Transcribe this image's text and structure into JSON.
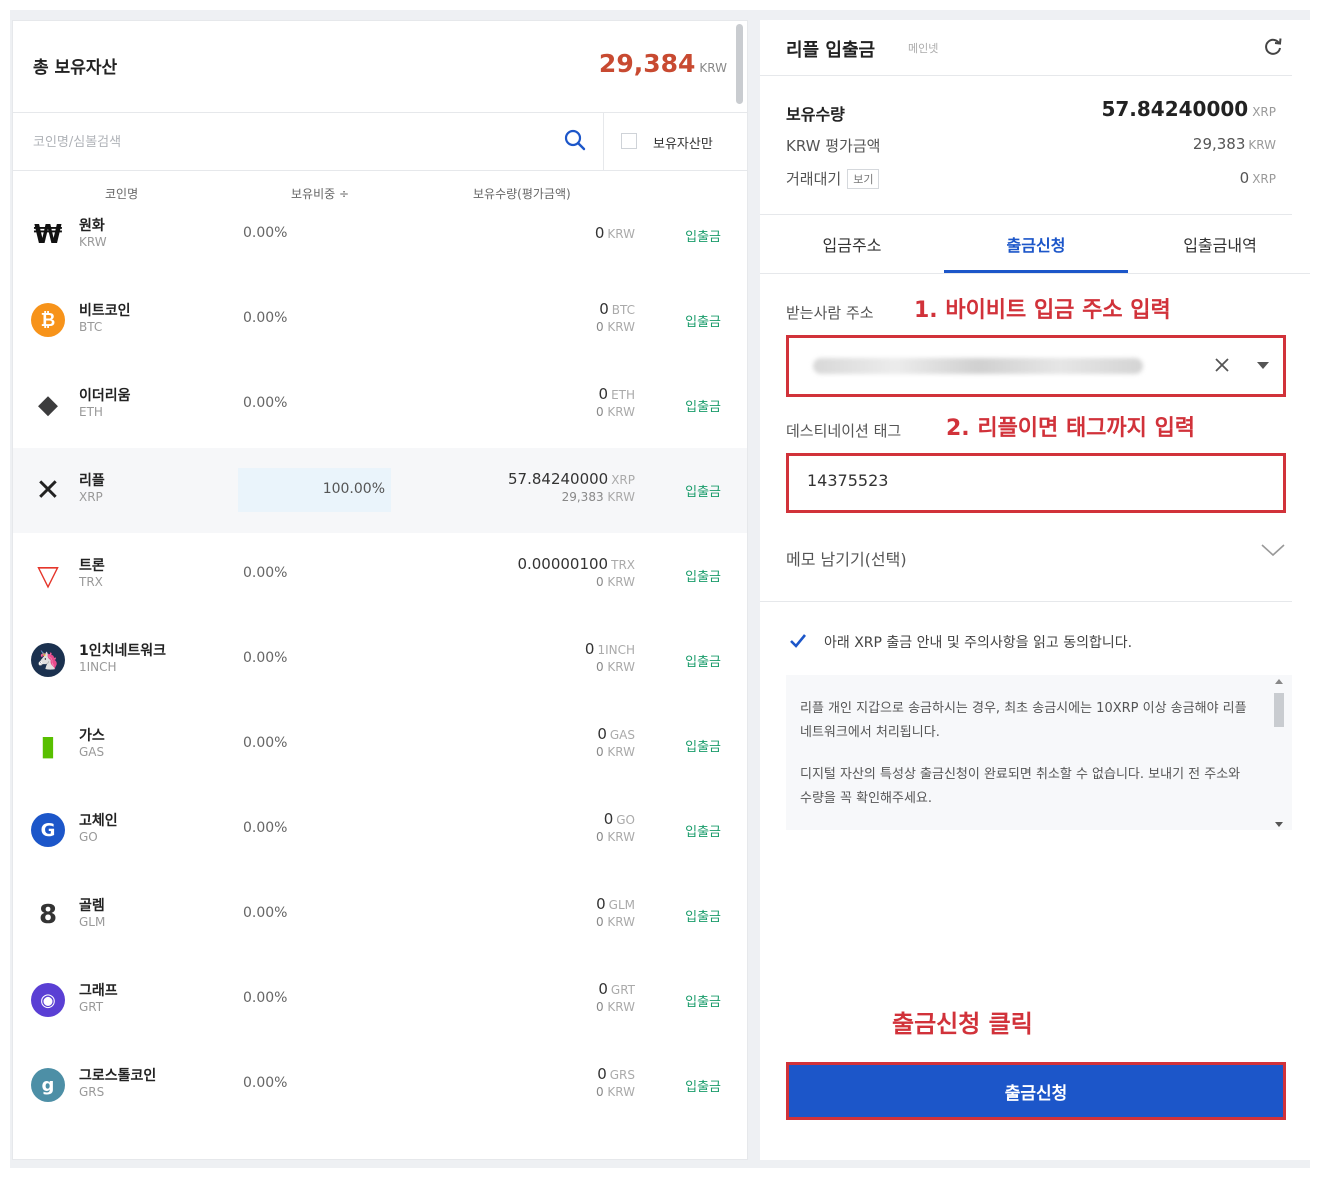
{
  "left": {
    "total_label": "총 보유자산",
    "total_value": "29,384",
    "total_unit": "KRW",
    "search_placeholder": "코인명/심볼검색",
    "owned_only_label": "보유자산만",
    "columns": {
      "name": "코인명",
      "ratio": "보유비중 ÷",
      "qty": "보유수량(평가금액)"
    },
    "coins": [
      {
        "name": "원화",
        "symbol": "KRW",
        "ratio": "0.00%",
        "qty": "0",
        "qty_unit": "KRW",
        "krw": "",
        "krw_unit": "",
        "action": "입출금",
        "icon": "won-icon",
        "color": "#ffffff"
      },
      {
        "name": "비트코인",
        "symbol": "BTC",
        "ratio": "0.00%",
        "qty": "0",
        "qty_unit": "BTC",
        "krw": "0",
        "krw_unit": "KRW",
        "action": "입출금",
        "icon": "bitcoin-icon",
        "color": "#f7931a"
      },
      {
        "name": "이더리움",
        "symbol": "ETH",
        "ratio": "0.00%",
        "qty": "0",
        "qty_unit": "ETH",
        "krw": "0",
        "krw_unit": "KRW",
        "action": "입출금",
        "icon": "ethereum-icon",
        "color": "#3c3c3d"
      },
      {
        "name": "리플",
        "symbol": "XRP",
        "ratio": "100.00%",
        "qty": "57.84240000",
        "qty_unit": "XRP",
        "krw": "29,383",
        "krw_unit": "KRW",
        "action": "입출금",
        "icon": "ripple-icon",
        "color": "#222222"
      },
      {
        "name": "트론",
        "symbol": "TRX",
        "ratio": "0.00%",
        "qty": "0.00000100",
        "qty_unit": "TRX",
        "krw": "0",
        "krw_unit": "KRW",
        "action": "입출금",
        "icon": "tron-icon",
        "color": "#e5362b"
      },
      {
        "name": "1인치네트워크",
        "symbol": "1INCH",
        "ratio": "0.00%",
        "qty": "0",
        "qty_unit": "1INCH",
        "krw": "0",
        "krw_unit": "KRW",
        "action": "입출금",
        "icon": "1inch-icon",
        "color": "#1b314f"
      },
      {
        "name": "가스",
        "symbol": "GAS",
        "ratio": "0.00%",
        "qty": "0",
        "qty_unit": "GAS",
        "krw": "0",
        "krw_unit": "KRW",
        "action": "입출금",
        "icon": "gas-icon",
        "color": "#58bf00"
      },
      {
        "name": "고체인",
        "symbol": "GO",
        "ratio": "0.00%",
        "qty": "0",
        "qty_unit": "GO",
        "krw": "0",
        "krw_unit": "KRW",
        "action": "입출금",
        "icon": "gochain-icon",
        "color": "#1c56c9"
      },
      {
        "name": "골렘",
        "symbol": "GLM",
        "ratio": "0.00%",
        "qty": "0",
        "qty_unit": "GLM",
        "krw": "0",
        "krw_unit": "KRW",
        "action": "입출금",
        "icon": "golem-icon",
        "color": "#333333"
      },
      {
        "name": "그래프",
        "symbol": "GRT",
        "ratio": "0.00%",
        "qty": "0",
        "qty_unit": "GRT",
        "krw": "0",
        "krw_unit": "KRW",
        "action": "입출금",
        "icon": "graph-icon",
        "color": "#5a3fd4"
      },
      {
        "name": "그로스톨코인",
        "symbol": "GRS",
        "ratio": "0.00%",
        "qty": "0",
        "qty_unit": "GRS",
        "krw": "0",
        "krw_unit": "KRW",
        "action": "입출금",
        "icon": "groestlcoin-icon",
        "color": "#4d8fa6"
      }
    ]
  },
  "right": {
    "title": "리플 입출금",
    "badge": "메인넷",
    "holding_label": "보유수량",
    "holding_value": "57.84240000",
    "holding_unit": "XRP",
    "krw_label": "KRW 평가금액",
    "krw_value": "29,383",
    "krw_unit": "KRW",
    "pending_label": "거래대기",
    "view_label": "보기",
    "pending_value": "0",
    "pending_unit": "XRP",
    "tabs": [
      "입금주소",
      "출금신청",
      "입출금내역"
    ],
    "active_tab": 1,
    "recipient_label": "받는사람 주소",
    "annotation1": "1. 바이비트 입금 주소 입력",
    "dest_tag_label": "데스티네이션 태그",
    "annotation2": "2. 리플이면 태그까지 입력",
    "dest_tag_value": "14375523",
    "memo_label": "메모 남기기(선택)",
    "agree_text": "아래 XRP 출금 안내 및 주의사항을 읽고 동의합니다.",
    "notice1": "리플 개인 지갑으로 송금하시는 경우, 최초 송금시에는 10XRP 이상 송금해야 리플 네트워크에서 처리됩니다.",
    "notice2": "디지털 자산의 특성상 출금신청이 완료되면 취소할 수 없습니다. 보내기 전 주소와 수량을 꼭 확인해주세요.",
    "click_annotation": "출금신청 클릭",
    "submit_label": "출금신청",
    "accent": "#1c56c9",
    "annotation_color": "#d1323a"
  }
}
